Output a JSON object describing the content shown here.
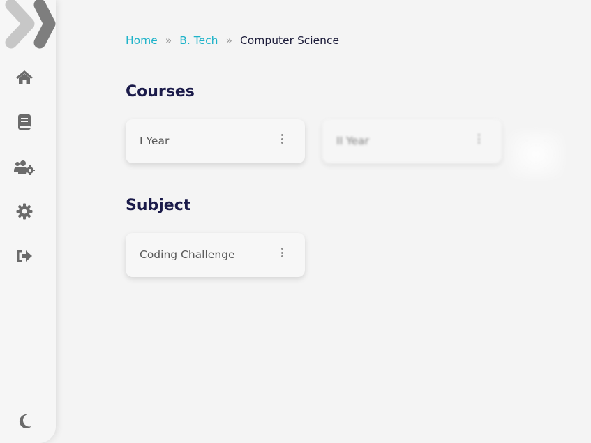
{
  "sidebar": {
    "logo_icon": "double-chevron-right-icon",
    "items": [
      {
        "name": "home",
        "icon": "home-icon"
      },
      {
        "name": "courses",
        "icon": "book-icon"
      },
      {
        "name": "users",
        "icon": "users-gear-icon"
      },
      {
        "name": "settings",
        "icon": "gear-icon"
      },
      {
        "name": "logout",
        "icon": "sign-out-icon"
      }
    ],
    "theme_toggle_icon": "moon-icon"
  },
  "breadcrumb": {
    "items": [
      "Home",
      "B. Tech",
      "Computer Science"
    ],
    "separator": "»"
  },
  "courses": {
    "title": "Courses",
    "cards": [
      {
        "label": "I Year"
      },
      {
        "label": "II Year"
      }
    ]
  },
  "subject": {
    "title": "Subject",
    "cards": [
      {
        "label": "Coding Challenge"
      }
    ]
  },
  "colors": {
    "accent": "#1fb3c9",
    "heading": "#1b1b4a",
    "icon": "#6b6b6b",
    "background": "#f4f4f4"
  }
}
